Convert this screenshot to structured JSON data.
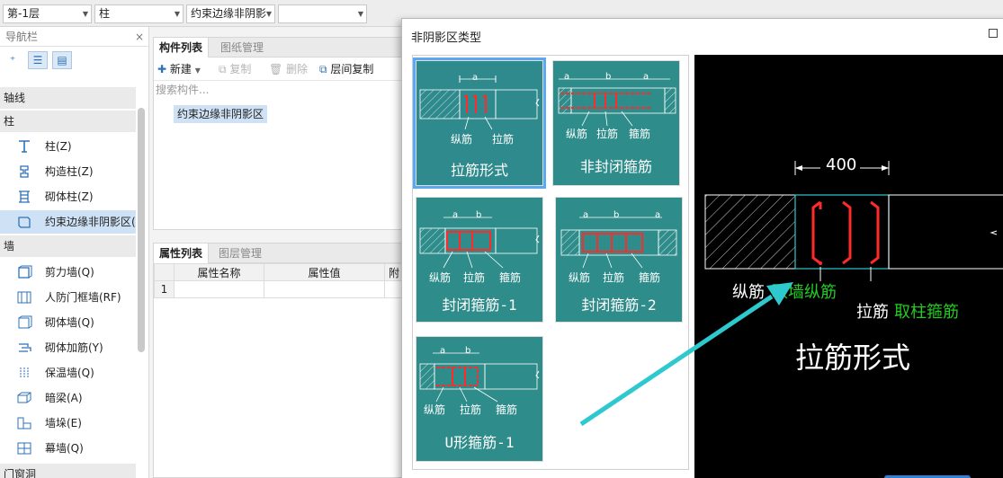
{
  "toolbar": {
    "floor": "第-1层",
    "category": "柱",
    "component": "约束边缘非阴影",
    "empty_value": ""
  },
  "nav": {
    "title": "导航栏",
    "close": "×",
    "categories": [
      "轴线",
      "柱",
      "墙",
      "门窗洞"
    ],
    "column_items": [
      "柱(Z)",
      "构造柱(Z)",
      "砌体柱(Z)",
      "约束边缘非阴影区("
    ],
    "wall_items": [
      "剪力墙(Q)",
      "人防门框墙(RF)",
      "砌体墙(Q)",
      "砌体加筋(Y)",
      "保温墙(Q)",
      "暗梁(A)",
      "墙垛(E)",
      "幕墙(Q)"
    ]
  },
  "component_panel": {
    "tabs": [
      "构件列表",
      "图纸管理"
    ],
    "actions": {
      "new": "新建",
      "copy": "复制",
      "delete": "删除",
      "floor_copy": "层间复制"
    },
    "search_placeholder": "搜索构件...",
    "items": [
      "约束边缘非阴影区"
    ]
  },
  "property_panel": {
    "tabs": [
      "属性列表",
      "图层管理"
    ],
    "columns": [
      "属性名称",
      "属性值",
      "附"
    ],
    "rows": [
      {
        "index": "1",
        "name": "",
        "value": ""
      }
    ]
  },
  "dialog": {
    "title": "非阴影区类型",
    "cards": [
      {
        "title": "拉筋形式",
        "dims": [
          "a"
        ],
        "labels": [
          "纵筋",
          "拉筋"
        ]
      },
      {
        "title": "非封闭箍筋",
        "dims": [
          "a",
          "b",
          "a"
        ],
        "labels": [
          "纵筋",
          "拉筋",
          "箍筋"
        ]
      },
      {
        "title": "封闭箍筋-1",
        "dims": [
          "a",
          "b"
        ],
        "labels": [
          "纵筋",
          "拉筋",
          "箍筋"
        ]
      },
      {
        "title": "封闭箍筋-2",
        "dims": [
          "a",
          "b",
          "a"
        ],
        "labels": [
          "纵筋",
          "拉筋",
          "箍筋"
        ]
      },
      {
        "title": "U形箍筋-1",
        "dims": [
          "a",
          "b"
        ],
        "labels": [
          "纵筋",
          "拉筋",
          "箍筋"
        ]
      }
    ],
    "preview": {
      "dimension": "400",
      "label_longitudinal": "纵筋",
      "label_longitudinal_source": "取墙纵筋",
      "label_tie": "拉筋",
      "label_tie_source": "取柱箍筋",
      "title": "拉筋形式"
    }
  },
  "colors": {
    "card_bg": "#2e8c8a",
    "selection": "#5aa8f0",
    "rebar": "#ff2a2a",
    "preview_green": "#22cc22",
    "arrow": "#2ec9cf"
  }
}
